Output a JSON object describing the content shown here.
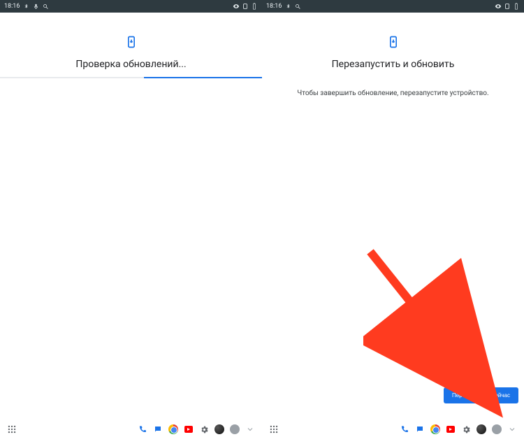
{
  "status": {
    "time": "18:16",
    "icons_left": [
      "bluetooth",
      "mic",
      "search"
    ],
    "icons_right": [
      "eye",
      "lock",
      "battery"
    ]
  },
  "screen_left": {
    "title": "Проверка обновлений...",
    "icon": "update-icon"
  },
  "screen_right": {
    "title": "Перезапустить и обновить",
    "subtitle": "Чтобы завершить обновление, перезапустите устройство.",
    "button": "Перезапустить сейчас",
    "icon": "update-icon"
  },
  "shelf": {
    "launcher": "launcher-icon",
    "apps": [
      "phone",
      "messages",
      "chrome",
      "youtube",
      "settings",
      "dark",
      "grey",
      "chevron"
    ]
  },
  "colors": {
    "accent": "#1a73e8",
    "statusbar": "#2e3a40",
    "arrow": "#ff3b1f"
  }
}
